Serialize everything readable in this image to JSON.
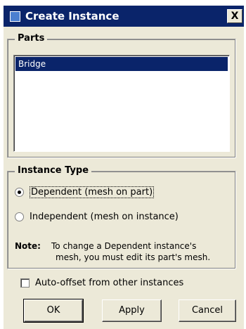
{
  "window": {
    "title": "Create Instance",
    "close_label": "X"
  },
  "parts": {
    "legend": "Parts",
    "items": [
      "Bridge"
    ],
    "selected": "Bridge"
  },
  "instance_type": {
    "legend": "Instance Type",
    "options": [
      {
        "label": "Dependent (mesh on part)",
        "selected": true
      },
      {
        "label": "Independent (mesh on instance)",
        "selected": false
      }
    ]
  },
  "note": {
    "label": "Note:",
    "line1": "To change a Dependent instance's",
    "line2": "mesh, you must edit its part's mesh."
  },
  "auto_offset": {
    "label": "Auto-offset from other instances",
    "checked": false
  },
  "buttons": {
    "ok": "OK",
    "apply": "Apply",
    "cancel": "Cancel"
  },
  "colors": {
    "titlebar": "#0a246a",
    "dialog_bg": "#ece9d8",
    "selection": "#0a246a"
  }
}
